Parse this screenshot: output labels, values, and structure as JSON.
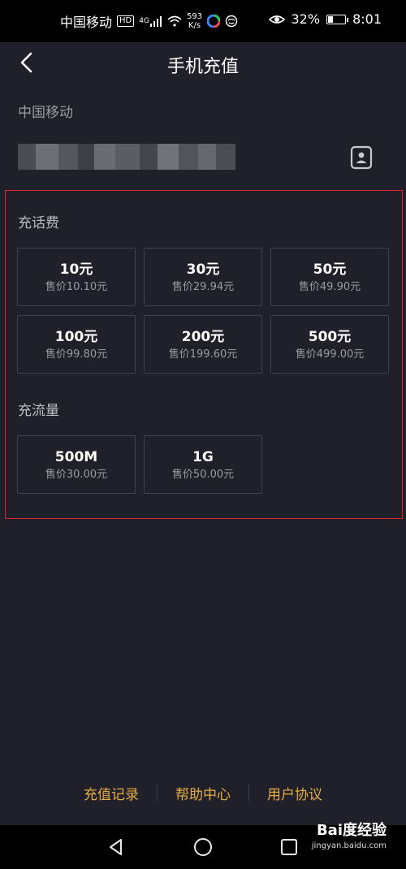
{
  "status_bar": {
    "carrier": "中国移动",
    "network_badge": "HD",
    "signal_label": "4G",
    "speed_value": "593",
    "speed_unit": "K/s",
    "battery": "32%",
    "battery_level": 0.32,
    "time": "8:01"
  },
  "header": {
    "title": "手机充值",
    "back_icon": "chevron-left-icon"
  },
  "account": {
    "carrier": "中国移动",
    "phone_number_obscured": true,
    "contact_icon": "contact-book-icon"
  },
  "call_credit": {
    "title": "充话费",
    "options": [
      {
        "amount": "10元",
        "price": "售价10.10元"
      },
      {
        "amount": "30元",
        "price": "售价29.94元"
      },
      {
        "amount": "50元",
        "price": "售价49.90元"
      },
      {
        "amount": "100元",
        "price": "售价99.80元"
      },
      {
        "amount": "200元",
        "price": "售价199.60元"
      },
      {
        "amount": "500元",
        "price": "售价499.00元"
      }
    ]
  },
  "data_plan": {
    "title": "充流量",
    "options": [
      {
        "amount": "500M",
        "price": "售价30.00元"
      },
      {
        "amount": "1G",
        "price": "售价50.00元"
      }
    ]
  },
  "footer": {
    "links": [
      "充值记录",
      "帮助中心",
      "用户协议"
    ]
  },
  "watermark": {
    "brand": "Bai度经验",
    "url": "jingyan.baidu.com"
  },
  "colors": {
    "background": "#1f2029",
    "link": "#e7ad44",
    "highlight_border": "#e0242a",
    "option_border": "#40424c"
  }
}
